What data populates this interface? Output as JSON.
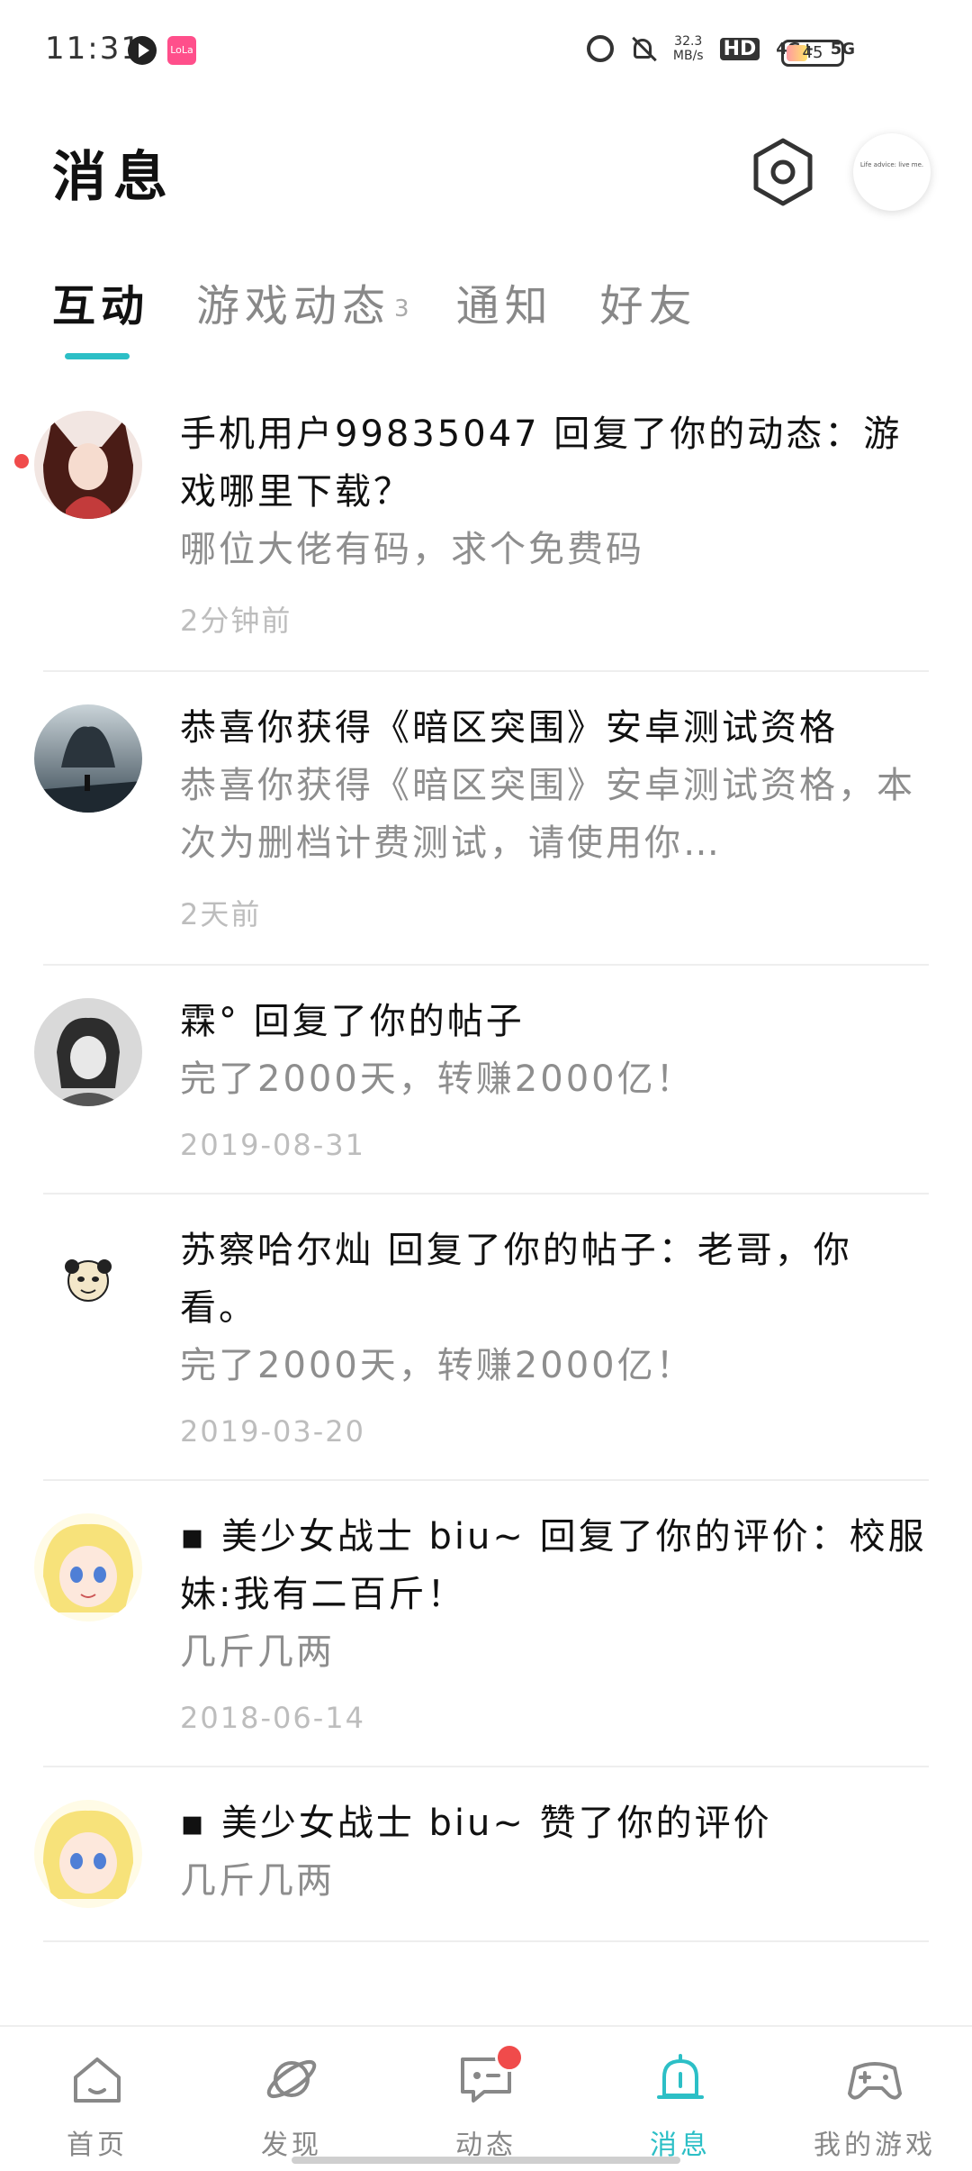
{
  "status_bar": {
    "time": "11:31",
    "app_badge": "LoLa",
    "net_speed": "32.3",
    "net_unit": "MB/s",
    "hd": "HD",
    "sim1": "4G+",
    "sim2": "5G",
    "battery": "45"
  },
  "header": {
    "title": "消息",
    "avatar_text": "Life advice: live me."
  },
  "tabs": [
    {
      "label": "互动",
      "active": true
    },
    {
      "label": "游戏动态",
      "count": "3"
    },
    {
      "label": "通知"
    },
    {
      "label": "好友"
    }
  ],
  "messages": [
    {
      "title": "手机用户99835047 回复了你的动态：游戏哪里下载？",
      "preview": "哪位大佬有码，求个免费码",
      "time": "2分钟前",
      "unread": true
    },
    {
      "title": "恭喜你获得《暗区突围》安卓测试资格",
      "preview": "恭喜你获得《暗区突围》安卓测试资格，本次为删档计费测试，请使用你…",
      "time": "2天前"
    },
    {
      "title": "霖° 回复了你的帖子",
      "preview": "完了2000天，转赚2000亿！",
      "time": "2019-08-31"
    },
    {
      "title": "苏察哈尔灿 回复了你的帖子：老哥，你看。",
      "preview": "完了2000天，转赚2000亿！",
      "time": "2019-03-20"
    },
    {
      "title": "▪ 美少女战士 biu~ 回复了你的评价：校服妹:我有二百斤！",
      "preview": "几斤几两",
      "time": "2018-06-14"
    },
    {
      "title": "▪ 美少女战士 biu~ 赞了你的评价",
      "preview": "几斤几两",
      "time": ""
    }
  ],
  "bottom_nav": [
    {
      "label": "首页",
      "icon": "home-icon"
    },
    {
      "label": "发现",
      "icon": "planet-icon"
    },
    {
      "label": "动态",
      "icon": "chat-icon",
      "badge": true
    },
    {
      "label": "消息",
      "icon": "bell-icon",
      "active": true
    },
    {
      "label": "我的游戏",
      "icon": "gamepad-icon"
    }
  ],
  "colors": {
    "accent": "#2cbfc6",
    "badge": "#f04b4b",
    "muted_text": "#8e8e8e"
  }
}
